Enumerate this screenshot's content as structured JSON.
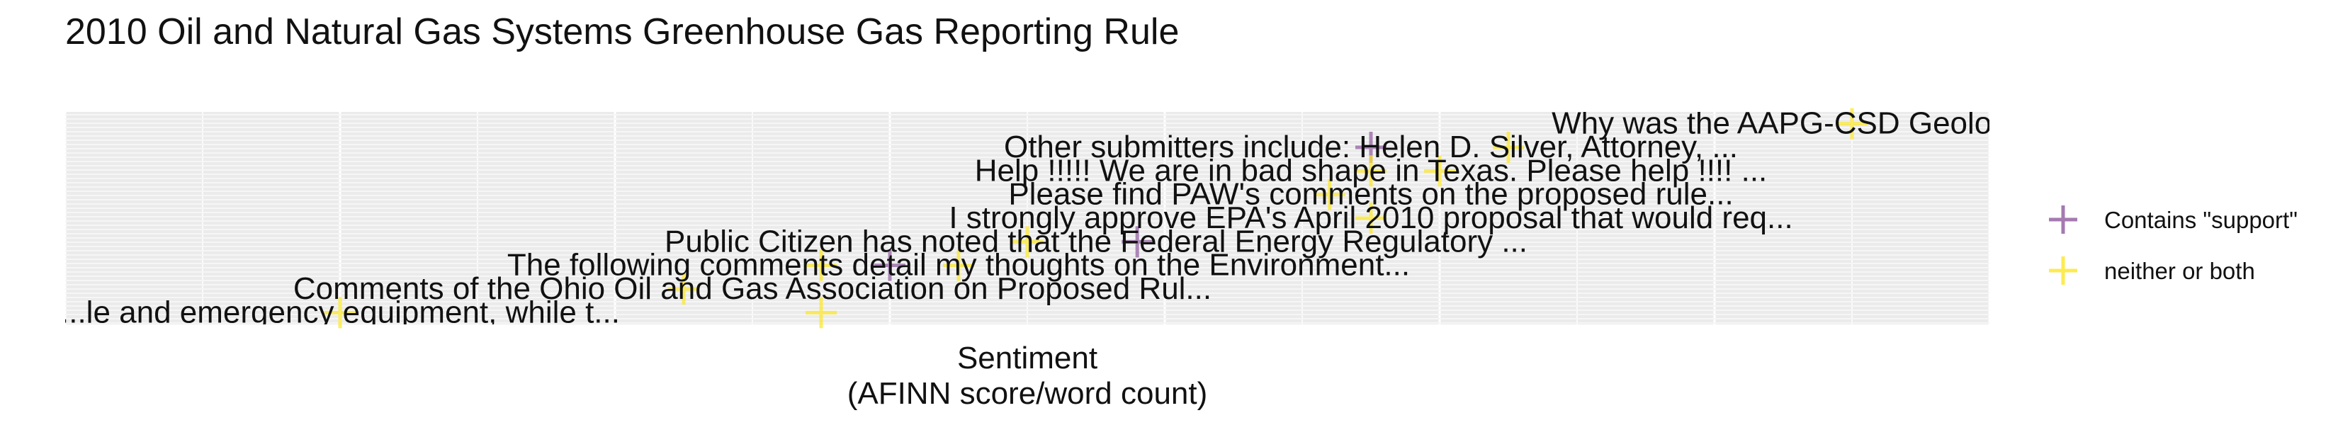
{
  "chart_data": {
    "type": "scatter",
    "title": "2010 Oil and Natural Gas Systems Greenhouse Gas Reporting Rule",
    "xlabel_line1": "Sentiment",
    "xlabel_line2": "(AFINN score/word count)",
    "ylabel": "",
    "grid": true,
    "legend_position": "right",
    "legend": [
      {
        "name": "Contains \"support\"",
        "marker": "plus",
        "color": "#8E5A9E"
      },
      {
        "name": "neither or both",
        "marker": "plus",
        "color": "#FDE725"
      }
    ],
    "labels": [
      {
        "text": "Why was the AAPG-CSD Geological Prov...",
        "x": 0.9,
        "y": 9
      },
      {
        "text": "Other submitters include: Helen D. Silver, Attorney, ...",
        "x": 0.55,
        "y": 8
      },
      {
        "text": "Help !!!!!  We are in bad shape in Texas.  Please help !!!! ...",
        "x": 0.55,
        "y": 7
      },
      {
        "text": "Please find PAW's comments on the proposed rule...",
        "x": 0.55,
        "y": 6
      },
      {
        "text": "I strongly approve EPA's April 2010  proposal that would req...",
        "x": 0.55,
        "y": 5
      },
      {
        "text": "Public Citizen has noted that the Federal Energy Regulatory ...",
        "x": 0.35,
        "y": 4
      },
      {
        "text": "The following comments detail my thoughts on the Environment...",
        "x": 0.25,
        "y": 3
      },
      {
        "text": "Comments of the Ohio Oil and Gas Association on Proposed Rul...",
        "x": 0.1,
        "y": 2
      },
      {
        "text": "...le and emergency equipment, while t...",
        "x": -0.2,
        "y": 1
      }
    ],
    "points": [
      {
        "x": 0.9,
        "y": 9,
        "group": "neither or both"
      },
      {
        "x": 0.55,
        "y": 8,
        "group": "Contains \"support\""
      },
      {
        "x": 0.65,
        "y": 8,
        "group": "neither or both"
      },
      {
        "x": 0.55,
        "y": 7,
        "group": "neither or both"
      },
      {
        "x": 0.6,
        "y": 7,
        "group": "neither or both"
      },
      {
        "x": 0.52,
        "y": 6,
        "group": "neither or both"
      },
      {
        "x": 0.55,
        "y": 5,
        "group": "neither or both"
      },
      {
        "x": 0.38,
        "y": 4,
        "group": "Contains \"support\""
      },
      {
        "x": 0.3,
        "y": 4,
        "group": "neither or both"
      },
      {
        "x": 0.25,
        "y": 3,
        "group": "neither or both"
      },
      {
        "x": 0.15,
        "y": 3,
        "group": "neither or both"
      },
      {
        "x": 0.2,
        "y": 3,
        "group": "Contains \"support\""
      },
      {
        "x": 0.05,
        "y": 2,
        "group": "neither or both"
      },
      {
        "x": -0.2,
        "y": 1,
        "group": "neither or both"
      },
      {
        "x": 0.15,
        "y": 1,
        "group": "neither or both"
      }
    ],
    "xlim": [
      -0.4,
      1.0
    ],
    "ylim": [
      0.5,
      9.5
    ]
  }
}
